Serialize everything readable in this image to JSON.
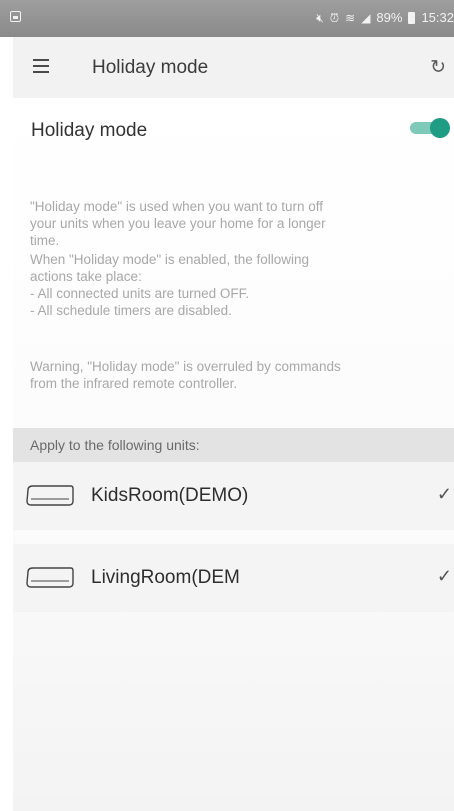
{
  "status_bar": {
    "icons": [
      "image-icon",
      "mute-icon",
      "alarm-icon",
      "wifi-icon",
      "signal-icon"
    ],
    "battery": "89%",
    "time": "15:32"
  },
  "app_bar": {
    "title": "Holiday mode",
    "menu_icon": "hamburger-menu-icon",
    "refresh_icon": "refresh-icon"
  },
  "holiday": {
    "label": "Holiday mode",
    "enabled": true,
    "description_1": "\"Holiday mode\" is used when you want to turn off\nyour units when you leave your home for a longer\ntime.",
    "description_2": "When \"Holiday mode\" is enabled, the following\nactions take place:\n- All connected units are turned OFF.\n- All schedule timers are disabled.",
    "description_3": "Warning, \"Holiday mode\" is overruled by commands\nfrom the infrared remote controller."
  },
  "apply_section": {
    "header": "Apply to the following units:",
    "units": [
      {
        "name": "KidsRoom(DEMO)",
        "checked": true
      },
      {
        "name": "LivingRoom(DEM",
        "checked": true
      }
    ]
  },
  "colors": {
    "accent": "#1e9c84",
    "accent_track": "#7fc9ba"
  }
}
